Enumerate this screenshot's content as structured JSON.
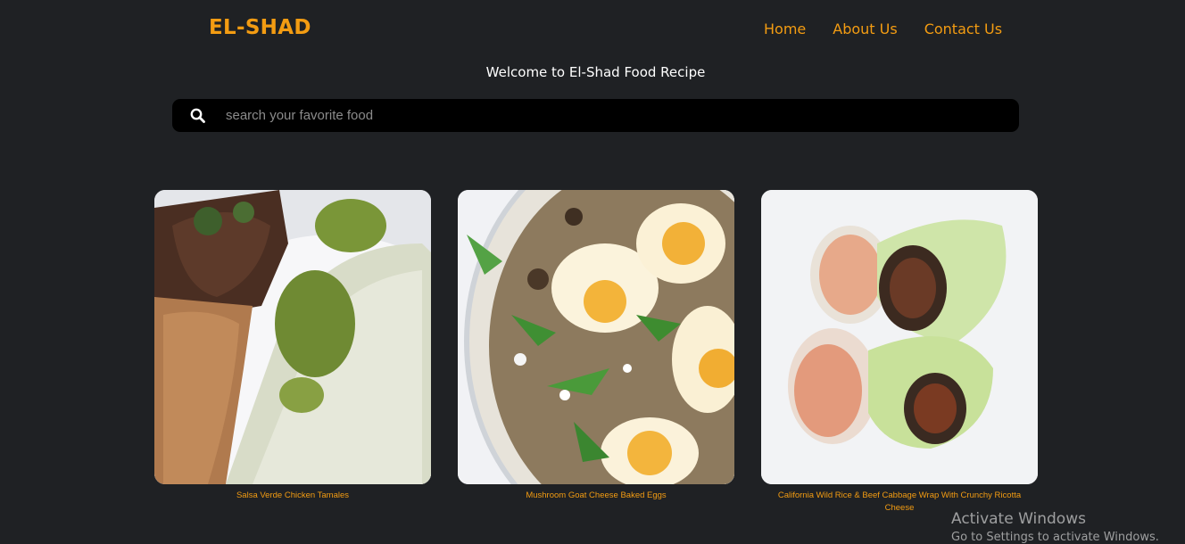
{
  "header": {
    "logo": "EL-SHAD",
    "nav": [
      "Home",
      "About Us",
      "Contact Us"
    ]
  },
  "welcome_text": "Welcome to El-Shad Food Recipe",
  "search": {
    "placeholder": "search your favorite food",
    "icon": "search-icon"
  },
  "recipes": [
    {
      "title": "Salsa Verde Chicken Tamales"
    },
    {
      "title": "Mushroom Goat Cheese Baked Eggs"
    },
    {
      "title": "California Wild Rice & Beef Cabbage Wrap With Crunchy Ricotta Cheese"
    }
  ],
  "watermark": {
    "line1": "Activate Windows",
    "line2": "Go to Settings to activate Windows."
  },
  "colors": {
    "background": "#1f2124",
    "accent": "#f39c12",
    "search_bg": "#000000"
  }
}
